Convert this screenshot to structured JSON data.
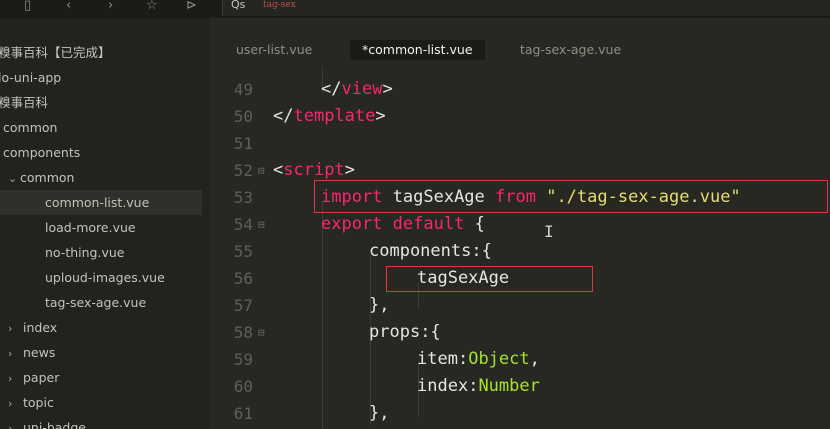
{
  "search": {
    "prefix": "Qs",
    "query": "tag-sex"
  },
  "sidebar": {
    "items": [
      {
        "label": "糗事百科【已完成】",
        "chev": ""
      },
      {
        "label": "lo-uni-app",
        "chev": ""
      },
      {
        "label": "糗事百科",
        "chev": ""
      },
      {
        "label": "common",
        "chev": ""
      },
      {
        "label": "components",
        "chev": ""
      },
      {
        "label": "common",
        "chev": "⌄"
      },
      {
        "label": "common-list.vue",
        "chev": ""
      },
      {
        "label": "load-more.vue",
        "chev": ""
      },
      {
        "label": "no-thing.vue",
        "chev": ""
      },
      {
        "label": "uploud-images.vue",
        "chev": ""
      },
      {
        "label": "tag-sex-age.vue",
        "chev": ""
      },
      {
        "label": "index",
        "chev": "›"
      },
      {
        "label": "news",
        "chev": "›"
      },
      {
        "label": "paper",
        "chev": "›"
      },
      {
        "label": "topic",
        "chev": "›"
      },
      {
        "label": "uni-badge",
        "chev": "›"
      }
    ]
  },
  "tabs": [
    {
      "label": "user-list.vue"
    },
    {
      "label": "*common-list.vue"
    },
    {
      "label": "tag-sex-age.vue"
    }
  ],
  "editor": {
    "line_numbers": [
      "49",
      "50",
      "51",
      "52",
      "53",
      "54",
      "55",
      "56",
      "57",
      "58",
      "59",
      "60",
      "61"
    ],
    "code": {
      "l49": {
        "open": "</",
        "tag": "view",
        "close": ">"
      },
      "l50": {
        "open": "</",
        "tag": "template",
        "close": ">"
      },
      "l52": {
        "open": "<",
        "tag": "script",
        "close": ">"
      },
      "l53": {
        "kw1": "import",
        "name": " tagSexAge ",
        "kw2": "from",
        "str": " \"./tag-sex-age.vue\""
      },
      "l54": {
        "kw1": "export",
        "kw2": "default",
        "brace": " {"
      },
      "l55": {
        "key": "components",
        "rest": ":{"
      },
      "l56": {
        "name": "tagSexAge"
      },
      "l57": {
        "text": "},"
      },
      "l58": {
        "key": "props",
        "rest": ":{"
      },
      "l59": {
        "key": "item",
        "colon": ":",
        "type": "Object",
        "comma": ","
      },
      "l60": {
        "key": "index",
        "colon": ":",
        "type": "Number"
      },
      "l61": {
        "text": "},"
      }
    }
  },
  "colors": {
    "highlight_box": "#e0353a",
    "keyword": "#f92672",
    "string": "#e6db74",
    "type": "#a6e22e"
  }
}
